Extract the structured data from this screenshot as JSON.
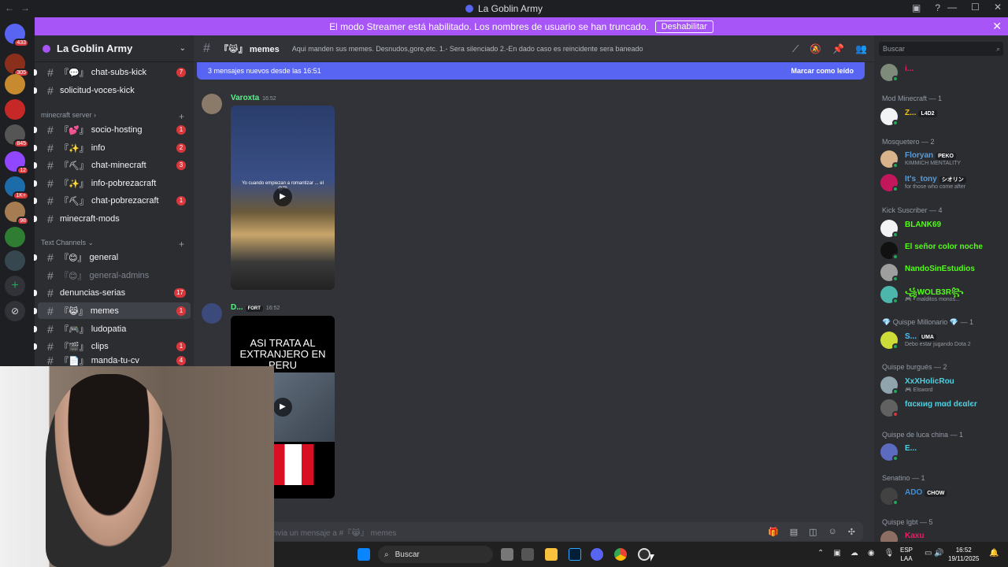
{
  "window": {
    "title": "La Goblin Army",
    "nav_back": "←",
    "nav_forward": "→",
    "minimize": "—",
    "maximize": "☐",
    "close": "✕"
  },
  "banner": {
    "text": "El modo Streamer está habilitado. Los nombres de usuario se han truncado.",
    "button": "Deshabilitar",
    "close": "✕"
  },
  "servers": {
    "badges": [
      "433",
      "305",
      "845",
      "12",
      "1K+",
      "98"
    ],
    "add_label": "+",
    "discover_label": "⊘"
  },
  "server": {
    "name": "La Goblin Army"
  },
  "channels": [
    {
      "icon": "『💬』",
      "name": "chat-subs-kick",
      "count": "7"
    },
    {
      "icon": "",
      "name": "solicitud-voces-kick",
      "count": ""
    },
    {
      "icon": "『💕』",
      "name": "socio-hosting",
      "count": "1"
    },
    {
      "icon": "『✨』",
      "name": "info",
      "count": "2"
    },
    {
      "icon": "『⛏』",
      "name": "chat-minecraft",
      "count": "3"
    },
    {
      "icon": "『✨』",
      "name": "info-pobrezacraft",
      "count": ""
    },
    {
      "icon": "『⛏』",
      "name": "chat-pobrezacraft",
      "count": "1"
    },
    {
      "icon": "",
      "name": "minecraft-mods",
      "count": ""
    },
    {
      "icon": "『😊』",
      "name": "general",
      "count": ""
    },
    {
      "icon": "『😊』",
      "name": "general-admins",
      "count": ""
    },
    {
      "icon": "",
      "name": "denuncias-serias",
      "count": "17"
    },
    {
      "icon": "『😹』",
      "name": "memes",
      "count": "1"
    },
    {
      "icon": "『🎮』",
      "name": "ludopatia",
      "count": ""
    },
    {
      "icon": "『🎬』",
      "name": "clips",
      "count": "1"
    },
    {
      "icon": "『📄』",
      "name": "manda-tu-cv",
      "count": "4"
    }
  ],
  "categories": {
    "minecraft": "minecraft server",
    "text": "Text Channels"
  },
  "channel_header": {
    "name": "『😹』 memes",
    "topic": "Aqui manden sus memes. Desnudos,gore,etc. 1.- Sera silenciado 2.-En dado caso es reincidente sera baneado"
  },
  "new_messages": {
    "text": "3 mensajes nuevos desde las 16:51",
    "action": "Marcar como leído"
  },
  "messages": [
    {
      "author": "Varoxta",
      "time": "16:52",
      "tag": "",
      "caption": "Yo cuando empiezan a romantizar ... el gym"
    },
    {
      "author": "D...",
      "time": "16:52",
      "tag": "FORT",
      "caption": "ASI TRATA AL EXTRANJERO EN PERU"
    }
  ],
  "composer": {
    "placeholder": "Envia un mensaje a #『😹』 memes"
  },
  "members": {
    "search_placeholder": "Buscar",
    "top_member": "i...",
    "groups": [
      {
        "label": "Mod Minecraft — 1"
      },
      {
        "label": "Mosquetero — 2"
      },
      {
        "label": "Kick Suscriber — 4"
      },
      {
        "label": "💎 Quispe Millonario 💎 — 1"
      },
      {
        "label": "Quispe burgués — 2"
      },
      {
        "label": "Quispe de luca china — 1"
      },
      {
        "label": "Senatino — 1"
      },
      {
        "label": "Quispe lgbt — 5"
      }
    ],
    "list": [
      {
        "name": "Z...",
        "badge": "L4D2",
        "sub": ""
      },
      {
        "name": "Floryan",
        "badge": "PEKO",
        "sub": "KIMMICH MENTALITY"
      },
      {
        "name": "It's_tony",
        "badge": "シオリン",
        "sub": "for those who come after"
      },
      {
        "name": "BLANK69",
        "badge": "",
        "sub": ""
      },
      {
        "name": "El señor color noche",
        "badge": "",
        "sub": ""
      },
      {
        "name": "NandoSinEstudios",
        "badge": "",
        "sub": ""
      },
      {
        "name": "꧁WOLB3R꧂",
        "badge": "",
        "sub": "🎮 • malditos monos..."
      },
      {
        "name": "S...",
        "badge": "UMA",
        "sub": "Debo estar jugando Dota 2"
      },
      {
        "name": "XxXHolicRou",
        "badge": "",
        "sub": "🎮 Elsword"
      },
      {
        "name": "fαcкιиg mαd dєαlєr",
        "badge": "",
        "sub": ""
      },
      {
        "name": "E...",
        "badge": "",
        "sub": ""
      },
      {
        "name": "ADO",
        "badge": "CHOW",
        "sub": ""
      },
      {
        "name": "Kaxu",
        "badge": "",
        "sub": ""
      }
    ]
  },
  "taskbar": {
    "search": "Buscar",
    "lang": "ESP",
    "lang2": "LAA",
    "time": "16:52",
    "date": "19/11/2025"
  },
  "colors": {
    "banner": "#a855f7",
    "new_messages": "#5865f2",
    "badge_red": "#da373c",
    "online": "#23a55a"
  }
}
